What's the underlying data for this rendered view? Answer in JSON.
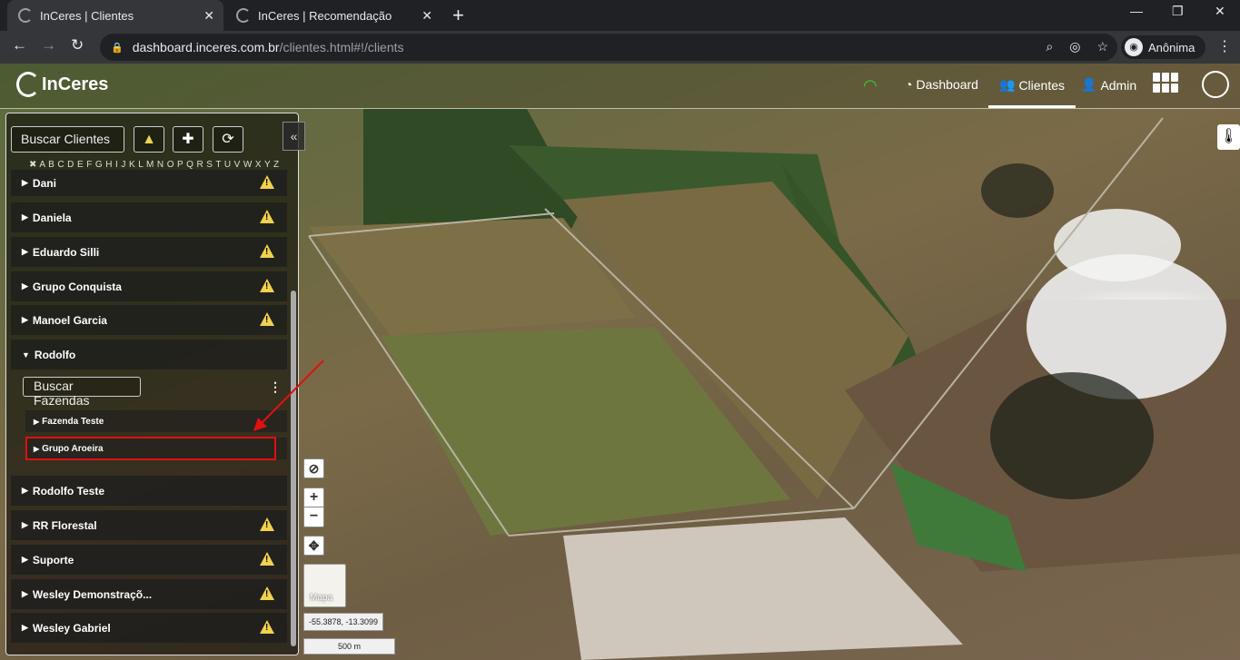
{
  "browser": {
    "tabs": [
      {
        "title": "InCeres | Clientes",
        "active": true
      },
      {
        "title": "InCeres | Recomendação",
        "active": false
      }
    ],
    "new_tab": "+",
    "url_host": "dashboard.inceres.com.br",
    "url_path": "/clientes.html#!/clients",
    "profile_label": "Anônima"
  },
  "app": {
    "logo_text": "InCeres",
    "nav": {
      "dashboard": "Dashboard",
      "clientes": "Clientes",
      "admin": "Admin"
    }
  },
  "panel": {
    "search_placeholder": "Buscar Clientes",
    "letters": "✖ A B C D E F G H I J K L M N O P Q R S T U V W X Y Z",
    "clients": [
      {
        "name": "Dani",
        "warning": true
      },
      {
        "name": "Daniela",
        "warning": true
      },
      {
        "name": "Eduardo Silli",
        "warning": true
      },
      {
        "name": "Grupo Conquista",
        "warning": true
      },
      {
        "name": "Manoel Garcia",
        "warning": true
      },
      {
        "name": "Rodolfo",
        "warning": false,
        "expanded": true
      },
      {
        "name": "Rodolfo Teste",
        "warning": false
      },
      {
        "name": "RR Florestal",
        "warning": true
      },
      {
        "name": "Suporte",
        "warning": true
      },
      {
        "name": "Wesley Demonstraçõ...",
        "warning": true
      },
      {
        "name": "Wesley Gabriel",
        "warning": true
      }
    ],
    "farm_search_placeholder": "Buscar Fazendas",
    "farms": [
      {
        "name": "Fazenda Teste"
      },
      {
        "name": "Grupo Aroeira"
      }
    ]
  },
  "map": {
    "minimap_label": "Mapa",
    "coords": "-55.3878, -13.3099",
    "scale": "500 m"
  },
  "colors": {
    "highlight": "#e01010",
    "warning": "#f0d24c",
    "wifi": "#3ccf3c"
  }
}
